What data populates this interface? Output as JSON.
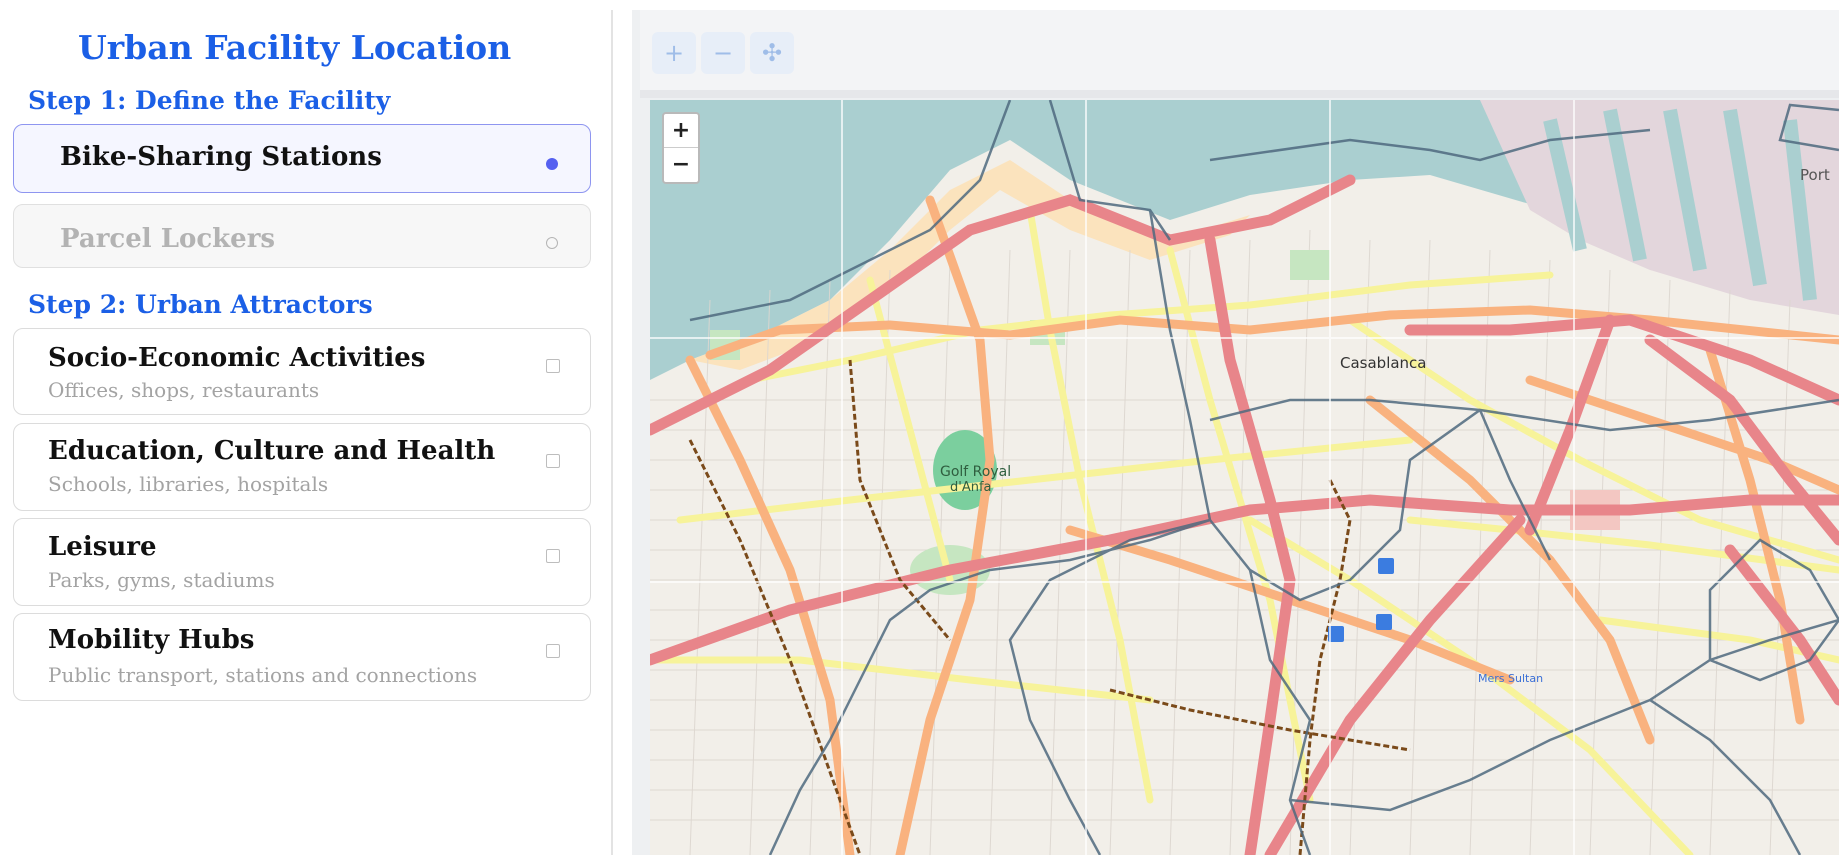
{
  "sidebar": {
    "title": "Urban Facility Location",
    "step1": {
      "title": "Step 1: Define the Facility",
      "options": [
        {
          "label": "Bike-Sharing Stations",
          "state": "selected"
        },
        {
          "label": "Parcel Lockers",
          "state": "disabled"
        }
      ]
    },
    "step2": {
      "title": "Step 2: Urban Attractors",
      "items": [
        {
          "label": "Socio-Economic Activities",
          "description": "Offices, shops, restaurants",
          "checked": false
        },
        {
          "label": "Education, Culture and Health",
          "description": "Schools, libraries, hospitals",
          "checked": false
        },
        {
          "label": "Leisure",
          "description": "Parks, gyms, stadiums",
          "checked": false
        },
        {
          "label": "Mobility Hubs",
          "description": "Public transport, stations and connections",
          "checked": false
        }
      ]
    }
  },
  "map": {
    "toolbar": {
      "zoom_in": "+",
      "zoom_out": "−",
      "pan": "✣"
    },
    "zoom_control": {
      "zoom_in": "+",
      "zoom_out": "−"
    },
    "labels": {
      "city": "Casablanca",
      "golf": "Golf Royal",
      "golf2": "d'Anfa",
      "port": "Port",
      "mers_sultan": "Mers Sultan"
    },
    "colors": {
      "sea": "#aacfd0",
      "land": "#f2efe9",
      "primary_road": "#e8858a",
      "secondary_road": "#f9b27f",
      "tertiary_road": "#f7f39a",
      "boundary": "#4f6a7f",
      "railway": "#7a4a1a"
    }
  }
}
